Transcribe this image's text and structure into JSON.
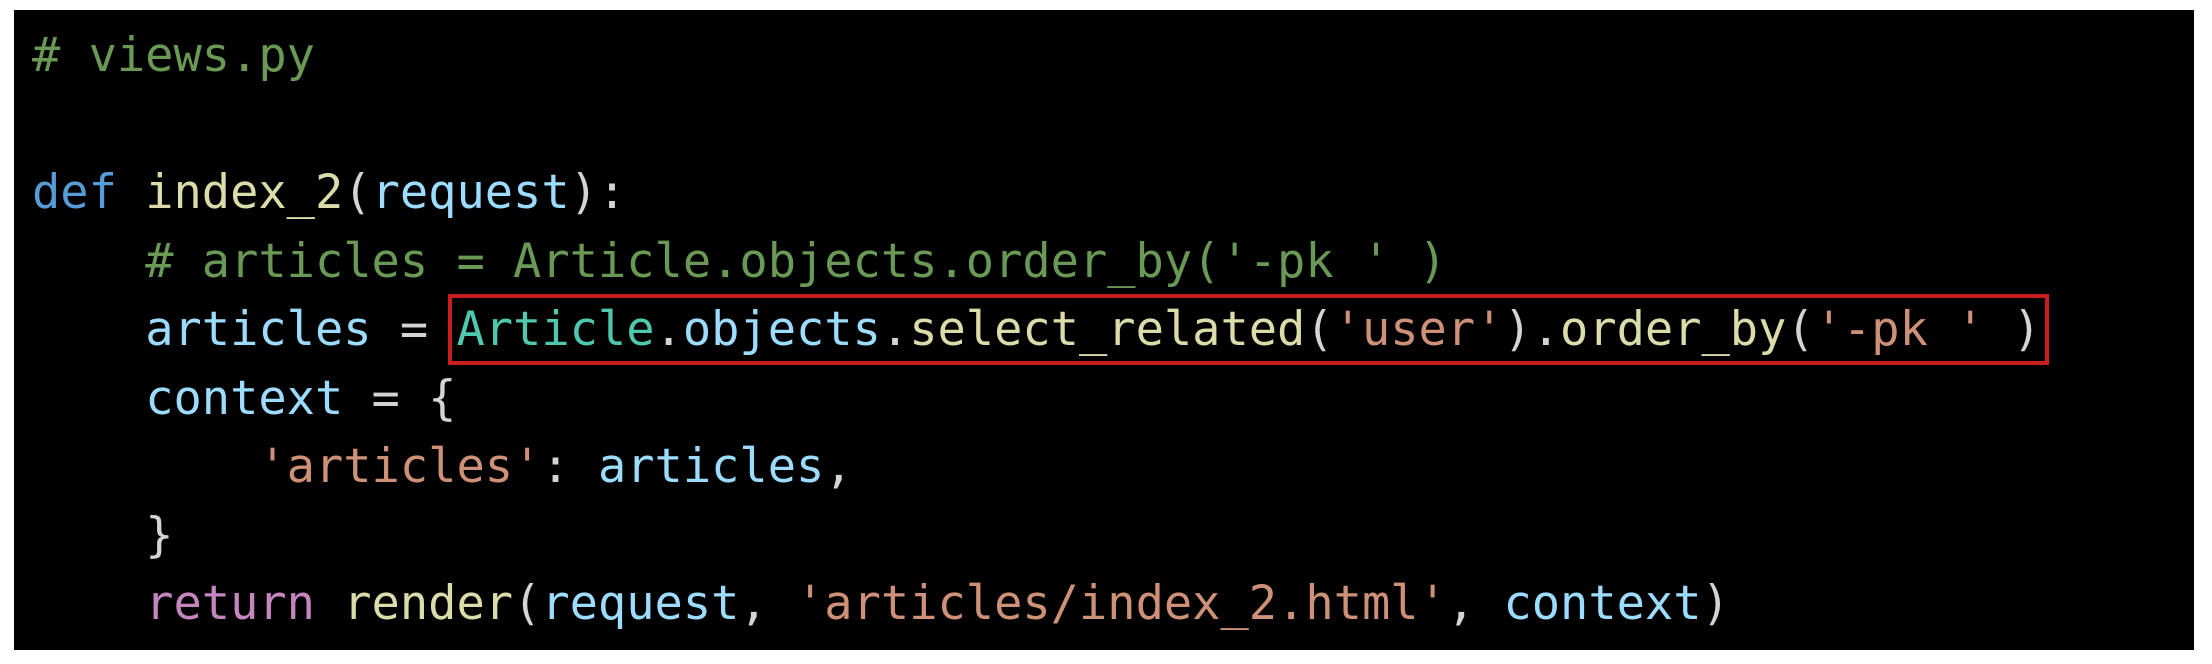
{
  "colors": {
    "background": "#000000",
    "comment": "#6a9955",
    "keyword": "#569cd6",
    "control": "#c586c0",
    "function": "#dcdcaa",
    "variable": "#9cdcfe",
    "class": "#4ec9b0",
    "string": "#ce9178",
    "punctuation": "#d4d4d4",
    "highlight": "#c81e1e"
  },
  "code": {
    "line1": {
      "comment": "# views.py"
    },
    "line3": {
      "keyword": "def",
      "func": "index_2",
      "open": "(",
      "param": "request",
      "close": "):"
    },
    "line4": {
      "comment": "# articles = Article.objects.order_by('-pk ' )"
    },
    "line5": {
      "var": "articles",
      "eq": " = ",
      "cls": "Article",
      "dot1": ".",
      "objects": "objects",
      "dot2": ".",
      "method1": "select_related",
      "open1": "(",
      "str1": "'user'",
      "close1": ")",
      "dot3": ".",
      "method2": "order_by",
      "open2": "(",
      "str2": "'-pk '",
      "close2": " )"
    },
    "line6": {
      "var": "context",
      "eq": " = {"
    },
    "line7": {
      "str": "'articles'",
      "colon": ": ",
      "var": "articles",
      "comma": ","
    },
    "line8": {
      "brace": "}"
    },
    "line9": {
      "keyword": "return",
      "sp": " ",
      "func": "render",
      "open": "(",
      "arg1": "request",
      "comma1": ", ",
      "str": "'articles/index_2.html'",
      "comma2": ", ",
      "arg3": "context",
      "close": ")"
    }
  }
}
